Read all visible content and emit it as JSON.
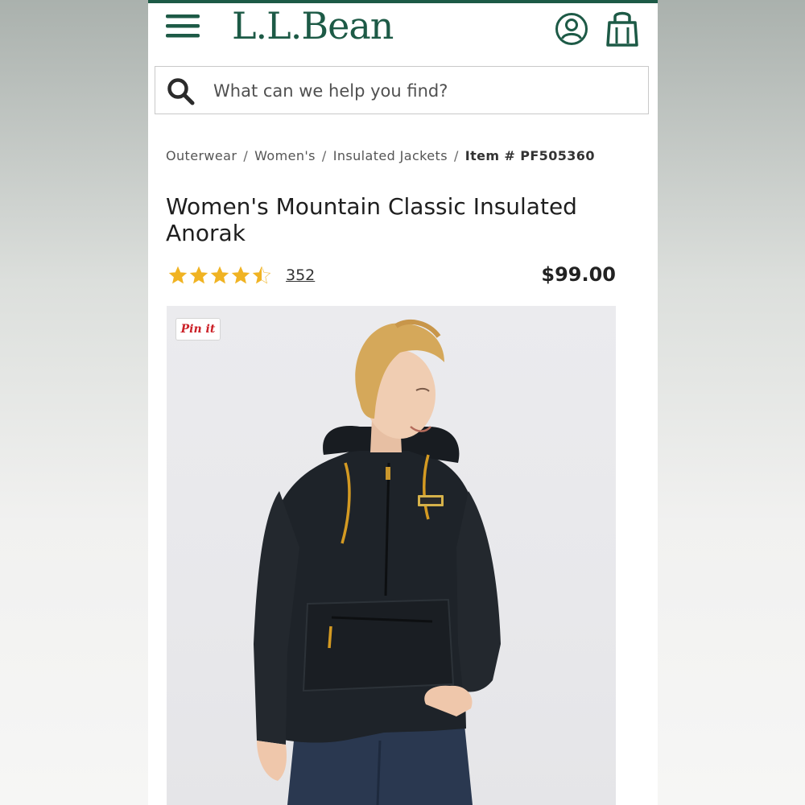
{
  "header": {
    "brand": "L.L.Bean",
    "menu_icon": "hamburger-menu-icon",
    "account_icon": "user-account-icon",
    "bag_icon": "shopping-bag-icon",
    "brand_color": "#1d5a46"
  },
  "search": {
    "placeholder": "What can we help you find?",
    "icon": "search-icon"
  },
  "breadcrumb": {
    "items": [
      "Outerwear",
      "Women's",
      "Insulated Jackets"
    ],
    "current": "Item # PF505360",
    "separator": "/"
  },
  "product": {
    "title": "Women's Mountain Classic Insulated Anorak",
    "rating": 4.5,
    "rating_max": 5,
    "review_count": "352",
    "price": "$99.00",
    "star_color": "#f0b323",
    "pin_label": "Pin it"
  }
}
